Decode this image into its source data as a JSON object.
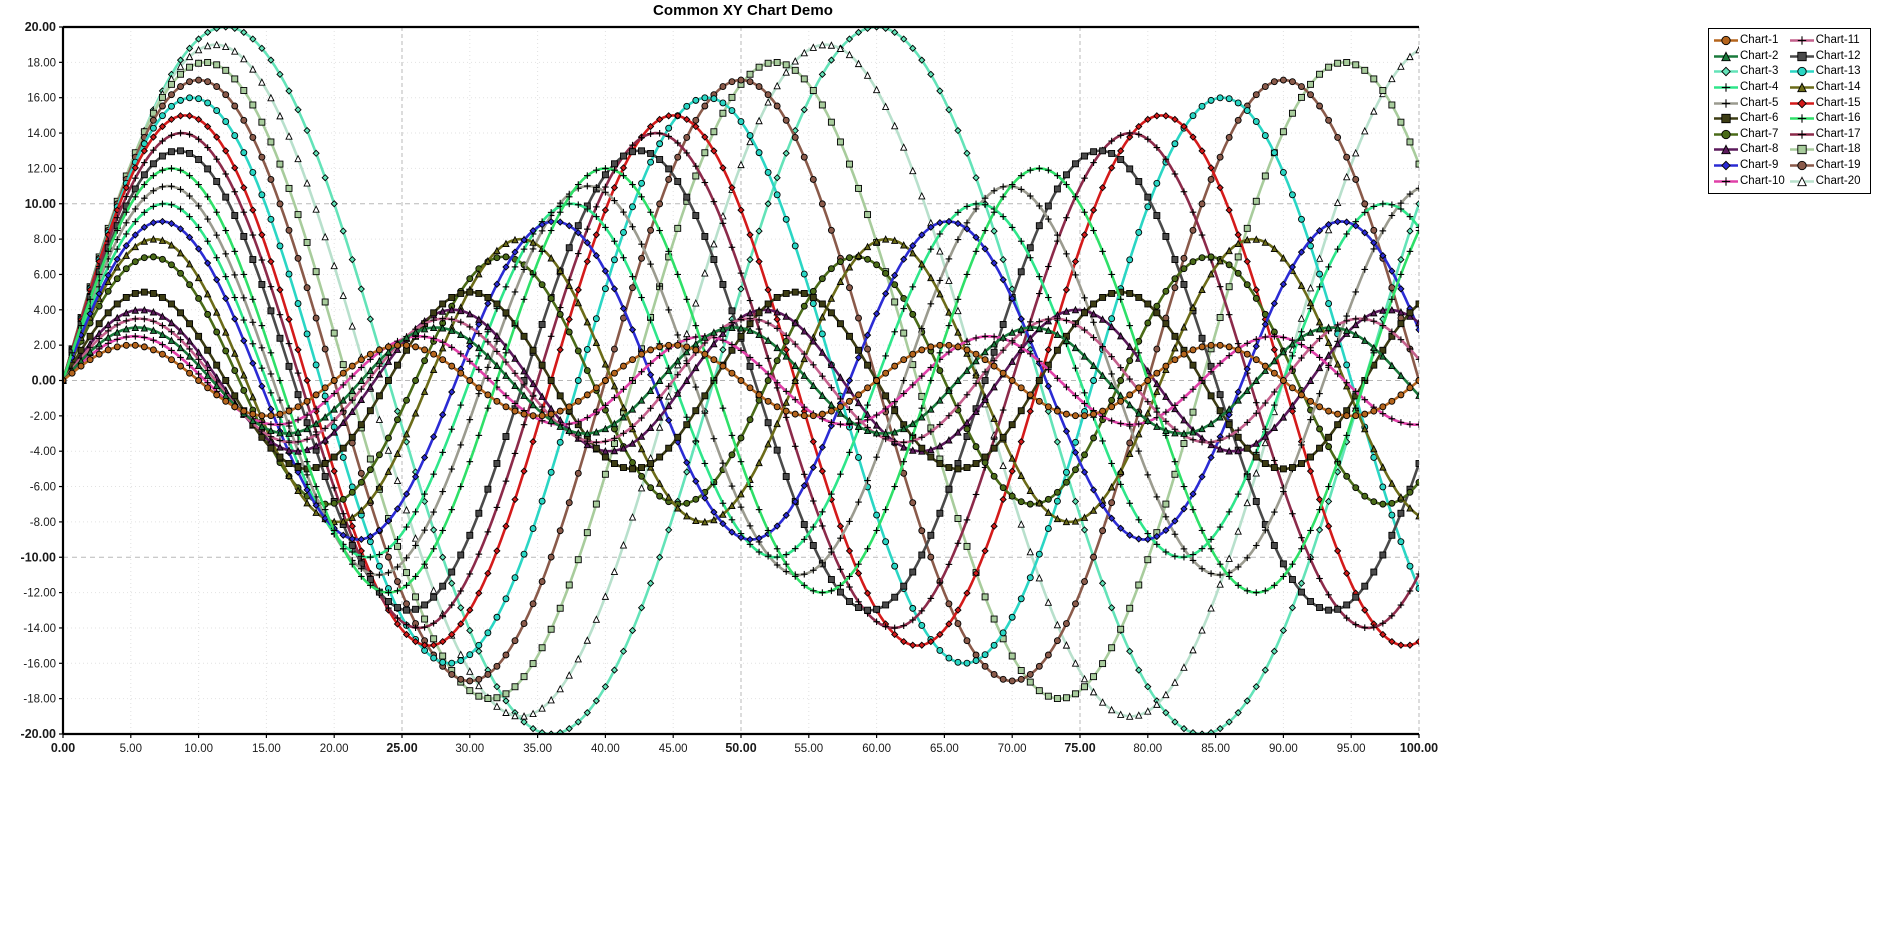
{
  "chart_data": {
    "type": "line",
    "title": "Common XY Chart Demo",
    "xlabel": "",
    "ylabel": "",
    "xlim": [
      0,
      100
    ],
    "ylim": [
      -20,
      20
    ],
    "grid": true,
    "legend_position": "right-outside",
    "x_ticks": [
      "0.00",
      "5.00",
      "10.00",
      "15.00",
      "20.00",
      "25.00",
      "30.00",
      "35.00",
      "40.00",
      "45.00",
      "50.00",
      "55.00",
      "60.00",
      "65.00",
      "70.00",
      "75.00",
      "80.00",
      "85.00",
      "90.00",
      "95.00",
      "100.00"
    ],
    "x_tick_values": [
      0,
      5,
      10,
      15,
      20,
      25,
      30,
      35,
      40,
      45,
      50,
      55,
      60,
      65,
      70,
      75,
      80,
      85,
      90,
      95,
      100
    ],
    "x_major_ticks": [
      0,
      25,
      50,
      75,
      100
    ],
    "y_ticks": [
      "20.00",
      "18.00",
      "16.00",
      "14.00",
      "12.00",
      "10.00",
      "8.00",
      "6.00",
      "4.00",
      "2.00",
      "0.00",
      "-2.00",
      "-4.00",
      "-6.00",
      "-8.00",
      "-10.00",
      "-12.00",
      "-14.00",
      "-16.00",
      "-18.00",
      "-20.00"
    ],
    "y_tick_values": [
      20,
      18,
      16,
      14,
      12,
      10,
      8,
      6,
      4,
      2,
      0,
      -2,
      -4,
      -6,
      -8,
      -10,
      -12,
      -14,
      -16,
      -18,
      -20
    ],
    "y_major_ticks": [
      20,
      10,
      0,
      -10,
      -20
    ],
    "point_count": 300,
    "series": [
      {
        "name": "Chart-1",
        "color": "#b5651d",
        "marker": "circle",
        "amplitude": 2.0,
        "period": 20.0,
        "phase": 0.0
      },
      {
        "name": "Chart-2",
        "color": "#1a7a3c",
        "marker": "triangle",
        "amplitude": 3.0,
        "period": 22.0,
        "phase": 0.0
      },
      {
        "name": "Chart-3",
        "color": "#63e3b8",
        "marker": "diamond",
        "amplitude": 20.0,
        "period": 48.0,
        "phase": 0.0
      },
      {
        "name": "Chart-4",
        "color": "#2ee68a",
        "marker": "plus",
        "amplitude": 10.0,
        "period": 30.0,
        "phase": 0.0
      },
      {
        "name": "Chart-5",
        "color": "#9b9b8f",
        "marker": "plus",
        "amplitude": 11.0,
        "period": 31.0,
        "phase": 0.0
      },
      {
        "name": "Chart-6",
        "color": "#3d3d14",
        "marker": "square",
        "amplitude": 5.0,
        "period": 24.0,
        "phase": 0.0
      },
      {
        "name": "Chart-7",
        "color": "#4a6b18",
        "marker": "circle",
        "amplitude": 7.0,
        "period": 26.0,
        "phase": 0.0
      },
      {
        "name": "Chart-8",
        "color": "#5c1a5c",
        "marker": "triangle",
        "amplitude": 4.0,
        "period": 23.0,
        "phase": 0.0
      },
      {
        "name": "Chart-9",
        "color": "#2b2bd4",
        "marker": "diamond",
        "amplitude": 9.0,
        "period": 29.0,
        "phase": 0.0
      },
      {
        "name": "Chart-10",
        "color": "#e040a8",
        "marker": "plus",
        "amplitude": 2.5,
        "period": 21.0,
        "phase": 0.0
      },
      {
        "name": "Chart-11",
        "color": "#c4608c",
        "marker": "plus",
        "amplitude": 3.5,
        "period": 22.5,
        "phase": 0.0
      },
      {
        "name": "Chart-12",
        "color": "#4a4a4a",
        "marker": "square",
        "amplitude": 13.0,
        "period": 34.0,
        "phase": 0.0
      },
      {
        "name": "Chart-13",
        "color": "#2ad6c4",
        "marker": "circle",
        "amplitude": 16.0,
        "period": 38.0,
        "phase": 0.0
      },
      {
        "name": "Chart-14",
        "color": "#6b6b18",
        "marker": "triangle",
        "amplitude": 8.0,
        "period": 27.0,
        "phase": 0.0
      },
      {
        "name": "Chart-15",
        "color": "#d41a1a",
        "marker": "diamond",
        "amplitude": 15.0,
        "period": 36.0,
        "phase": 0.0
      },
      {
        "name": "Chart-16",
        "color": "#2ee068",
        "marker": "plus",
        "amplitude": 12.0,
        "period": 32.0,
        "phase": 0.0
      },
      {
        "name": "Chart-17",
        "color": "#8c2a4a",
        "marker": "plus",
        "amplitude": 14.0,
        "period": 35.0,
        "phase": 0.0
      },
      {
        "name": "Chart-18",
        "color": "#a8cc9c",
        "marker": "square",
        "amplitude": 18.0,
        "period": 42.0,
        "phase": 0.0
      },
      {
        "name": "Chart-19",
        "color": "#8a5a4a",
        "marker": "circle",
        "amplitude": 17.0,
        "period": 40.0,
        "phase": 0.0
      },
      {
        "name": "Chart-20",
        "color": "#b8e0cc",
        "marker": "triangle-open",
        "amplitude": 19.0,
        "period": 45.0,
        "phase": 0.0
      }
    ]
  },
  "legend": {
    "columns": [
      [
        "Chart-1",
        "Chart-2",
        "Chart-3",
        "Chart-4",
        "Chart-5",
        "Chart-6",
        "Chart-7",
        "Chart-8",
        "Chart-9",
        "Chart-10"
      ],
      [
        "Chart-11",
        "Chart-12",
        "Chart-13",
        "Chart-14",
        "Chart-15",
        "Chart-16",
        "Chart-17",
        "Chart-18",
        "Chart-19",
        "Chart-20"
      ]
    ]
  },
  "style": {
    "background": "#ffffff",
    "axis_color": "#000000",
    "grid_minor_color": "#e2e2e2",
    "grid_major_color": "#b8b8b8",
    "tick_label_color": "#1a1a1a"
  }
}
